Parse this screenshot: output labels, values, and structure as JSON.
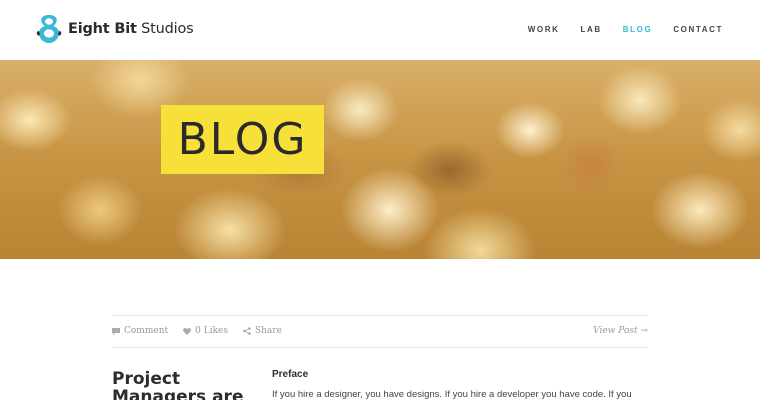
{
  "brand": {
    "name_bold": "Eight Bit",
    "name_rest": " Studios",
    "accent_color": "#3bb8d6",
    "logo_icon": "eight-bit-logo-icon"
  },
  "nav": {
    "items": [
      {
        "label": "WORK",
        "active": false
      },
      {
        "label": "LAB",
        "active": false
      },
      {
        "label": "BLOG",
        "active": true
      },
      {
        "label": "CONTACT",
        "active": false
      }
    ]
  },
  "hero": {
    "title": "BLOG",
    "title_bg_color": "#f7e03a"
  },
  "post_meta": {
    "comment_label": "Comment",
    "likes_label": "0 Likes",
    "share_label": "Share",
    "view_post_label": "View Post →"
  },
  "post": {
    "title": "Project Managers are",
    "section_heading": "Preface",
    "body": "If you hire a designer, you have designs. If you hire a developer you have code. If you"
  }
}
